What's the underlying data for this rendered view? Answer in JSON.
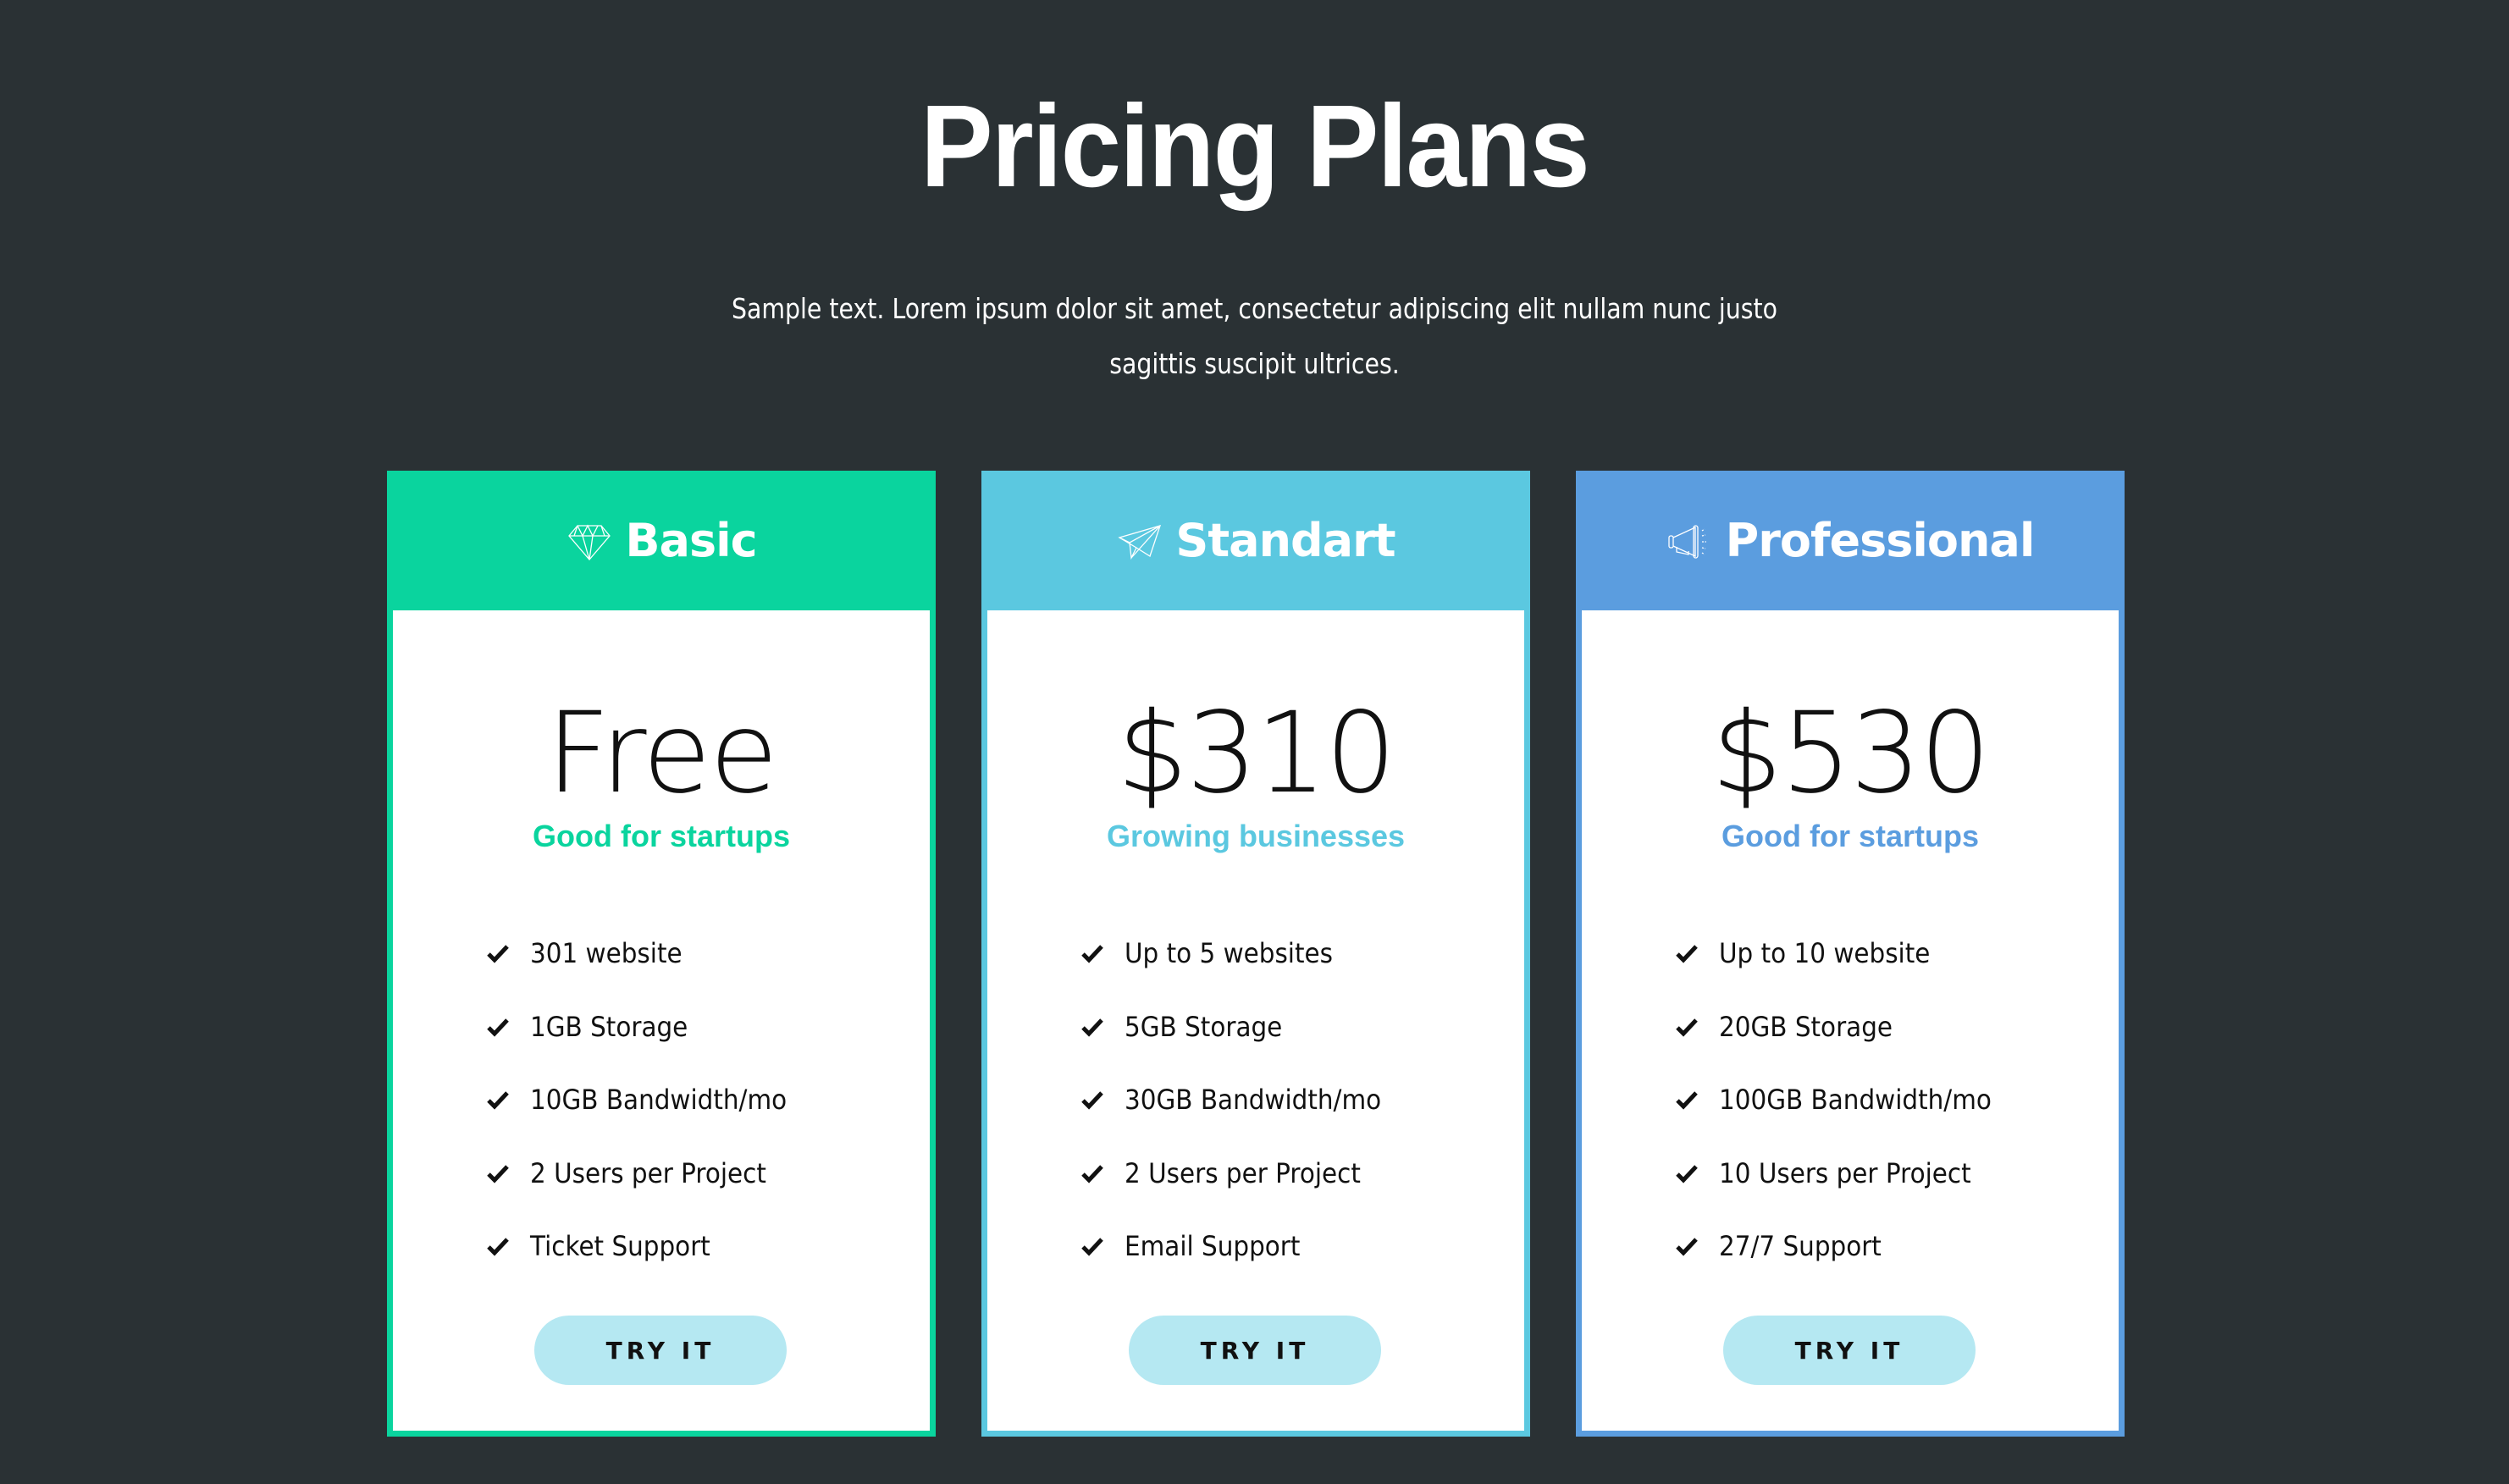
{
  "page": {
    "title": "Pricing Plans",
    "subtitle": "Sample text. Lorem ipsum dolor sit amet, consectetur adipiscing elit nullam nunc justo sagittis suscipit ultrices."
  },
  "colors": {
    "background": "#2a3134",
    "basic": "#0ad49e",
    "standart": "#5bc8e0",
    "professional": "#5b9ddf",
    "button": "#b5e8f2"
  },
  "plans": [
    {
      "name": "Basic",
      "icon": "diamond-icon",
      "price": "Free",
      "tagline": "Good for startups",
      "features": [
        "301 website",
        "1GB Storage",
        "10GB Bandwidth/mo",
        "2 Users per Project",
        "Ticket Support"
      ],
      "button": "TRY IT"
    },
    {
      "name": "Standart",
      "icon": "paper-plane-icon",
      "price": "$310",
      "tagline": "Growing businesses",
      "features": [
        "Up to 5 websites",
        "5GB Storage",
        "30GB Bandwidth/mo",
        "2 Users per Project",
        "Email Support"
      ],
      "button": "TRY IT"
    },
    {
      "name": "Professional",
      "icon": "megaphone-icon",
      "price": "$530",
      "tagline": "Good for startups",
      "features": [
        "Up to 10 website",
        "20GB Storage",
        "100GB Bandwidth/mo",
        "10 Users per Project",
        "27/7 Support"
      ],
      "button": "TRY IT"
    }
  ]
}
